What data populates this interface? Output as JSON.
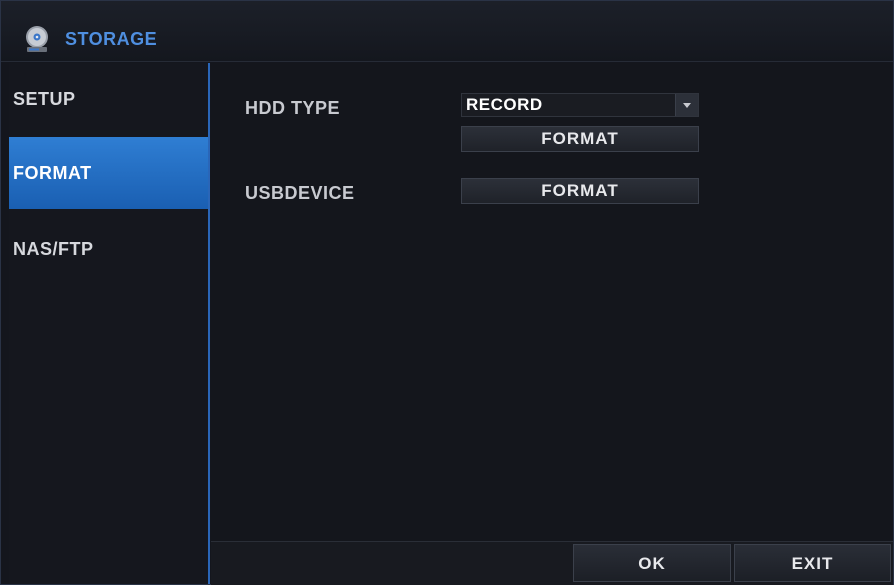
{
  "window": {
    "title": "STORAGE",
    "title_icon": "disc-storage-icon",
    "accent_color": "#2f7ed3"
  },
  "sidebar": {
    "items": [
      {
        "label": "SETUP",
        "active": false
      },
      {
        "label": "FORMAT",
        "active": true
      },
      {
        "label": "NAS/FTP",
        "active": false
      }
    ]
  },
  "main": {
    "hdd_type_label": "HDD TYPE",
    "hdd_type_value": "RECORD",
    "hdd_format_label": "FORMAT",
    "usb_device_label": "USBDEVICE",
    "usb_format_label": "FORMAT"
  },
  "footer": {
    "ok_label": "OK",
    "exit_label": "EXIT"
  }
}
